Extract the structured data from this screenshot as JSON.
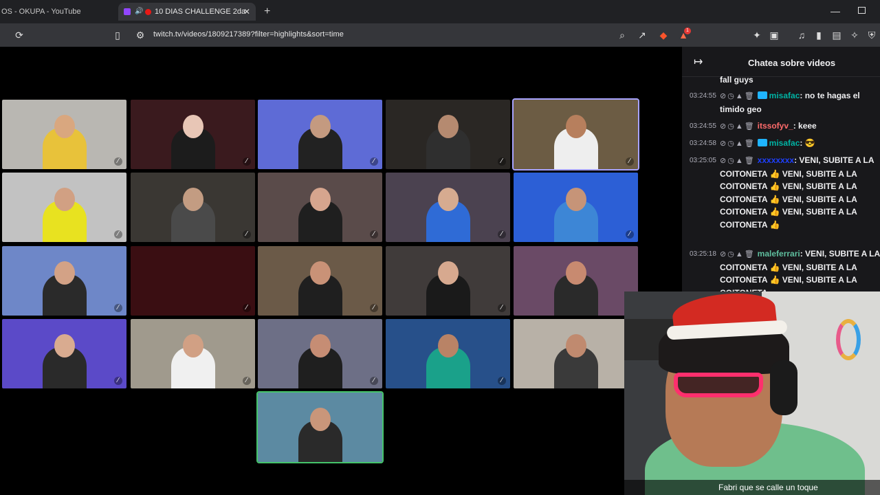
{
  "browser": {
    "tabs": [
      {
        "title": "OS - OKUPA - YouTube"
      },
      {
        "title": "10 DIAS CHALLENGE 2da"
      }
    ],
    "url": "twitch.tv/videos/1809217389?filter=highlights&sort=time",
    "notification_count": "1"
  },
  "chat": {
    "title": "Chatea sobre videos",
    "messages": [
      {
        "time": "",
        "user": "",
        "text": "fall guys",
        "user_color": "#efeff1"
      },
      {
        "time": "03:24:55",
        "user": "misafac",
        "text": " no te hagas el timido geo",
        "user_color": "#00b3a4"
      },
      {
        "time": "03:24:55",
        "user": "itssofyv_",
        "text": " keee",
        "user_color": "#ff6b6b"
      },
      {
        "time": "03:24:58",
        "user": "misafac",
        "text": " 😎",
        "user_color": "#00b3a4"
      },
      {
        "time": "03:25:05",
        "user": "xxxxxxxx",
        "text": " VENI, SUBITE A LA COITONETA 👍 VENI, SUBITE A LA COITONETA 👍 VENI, SUBITE A LA COITONETA 👍 VENI, SUBITE A LA COITONETA 👍 VENI, SUBITE A LA COITONETA 👍",
        "user_color": "#1e40ff"
      },
      {
        "time": "03:25:18",
        "user": "maleferrari",
        "text": " VENI, SUBITE A LA COITONETA 👍 VENI, SUBITE A LA COITONETA 👍 VENI, SUBITE A LA COITONETA",
        "user_color": "#5fbf9f"
      }
    ]
  },
  "stream": {
    "caption": "Fabri que se calle un toque"
  },
  "grid": {
    "tiles": [
      {
        "bg": "#b9b7b2",
        "skin": "#d9a77f",
        "shirt": "#e8c23a"
      },
      {
        "bg": "#3a1a1e",
        "skin": "#e8c6b6",
        "shirt": "#1c1c1c"
      },
      {
        "bg": "#5e6bd6",
        "skin": "#c49a80",
        "shirt": "#222"
      },
      {
        "bg": "#2a2724",
        "skin": "#b58a70",
        "shirt": "#2f2f2f"
      },
      {
        "bg": "#6c5c44",
        "skin": "#b77f5d",
        "shirt": "#eeeeee"
      },
      {
        "bg": "#c2c2c2",
        "skin": "#d1a083",
        "shirt": "#e8e220"
      },
      {
        "bg": "#3a3733",
        "skin": "#c39c82",
        "shirt": "#4a4a4a"
      },
      {
        "bg": "#5a4b4a",
        "skin": "#d6a58e",
        "shirt": "#1f1f1f"
      },
      {
        "bg": "#4b4250",
        "skin": "#d6ab90",
        "shirt": "#2f6bd6"
      },
      {
        "bg": "#2c5fd6",
        "skin": "#c69478",
        "shirt": "#3d86d6"
      },
      {
        "bg": "#6e87c8",
        "skin": "#d3a286",
        "shirt": "#2a2a2a"
      },
      {
        "bg": "#3a0e12",
        "skin": "#3a0e12",
        "shirt": "#3a0e12"
      },
      {
        "bg": "#6b5a48",
        "skin": "#c99277",
        "shirt": "#1f1f1f"
      },
      {
        "bg": "#403b3a",
        "skin": "#d7a98f",
        "shirt": "#1a1a1a"
      },
      {
        "bg": "#6a4a66",
        "skin": "#c88a70",
        "shirt": "#2a2a2a"
      },
      {
        "bg": "#5b4ac8",
        "skin": "#d9ab90",
        "shirt": "#2a2a2a"
      },
      {
        "bg": "#a09a8d",
        "skin": "#d1a084",
        "shirt": "#f0f0f0"
      },
      {
        "bg": "#6d6f86",
        "skin": "#c68d74",
        "shirt": "#1f1f1f"
      },
      {
        "bg": "#27508a",
        "skin": "#b98366",
        "shirt": "#1aa18a"
      },
      {
        "bg": "#b8b1a7",
        "skin": "#c08a6f",
        "shirt": "#3a3a3a"
      },
      {
        "bg": "#5c8aa2",
        "skin": "#c9967a",
        "shirt": "#2a2a2a"
      }
    ]
  }
}
